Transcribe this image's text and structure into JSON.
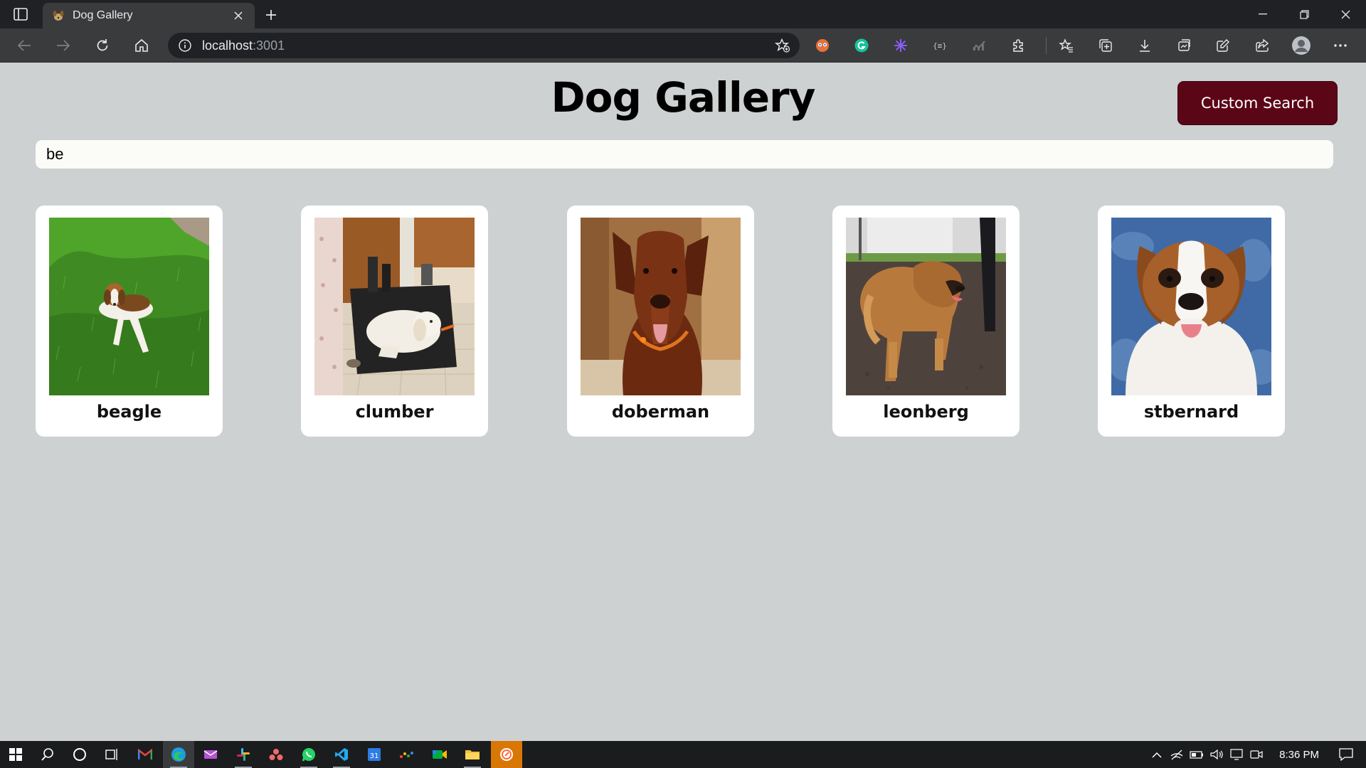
{
  "browser": {
    "tab_title": "Dog Gallery",
    "url_host": "localhost",
    "url_port": ":3001"
  },
  "page": {
    "title": "Dog Gallery",
    "custom_search_label": "Custom Search",
    "search_value": "be"
  },
  "dogs": [
    {
      "name": "beagle"
    },
    {
      "name": "clumber"
    },
    {
      "name": "doberman"
    },
    {
      "name": "leonberg"
    },
    {
      "name": "stbernard"
    }
  ],
  "taskbar": {
    "time": "8:36 PM"
  },
  "colors": {
    "page_bg": "#cdd1d1",
    "button_bg": "#5b0617",
    "card_bg": "#ffffff",
    "chrome_dark": "#202124",
    "chrome_toolbar": "#3a3b3d"
  },
  "icons": {
    "extensions": [
      "honey-extension-icon",
      "grammarly-extension-icon",
      "ai-extension-icon",
      "json-extension-icon",
      "analytics-extension-icon",
      "puzzle-extensions-icon",
      "favorites-icon",
      "collections-icon",
      "downloads-icon",
      "screenshot-icon",
      "edit-icon",
      "share-icon",
      "profile-avatar-icon",
      "more-menu-icon"
    ]
  }
}
